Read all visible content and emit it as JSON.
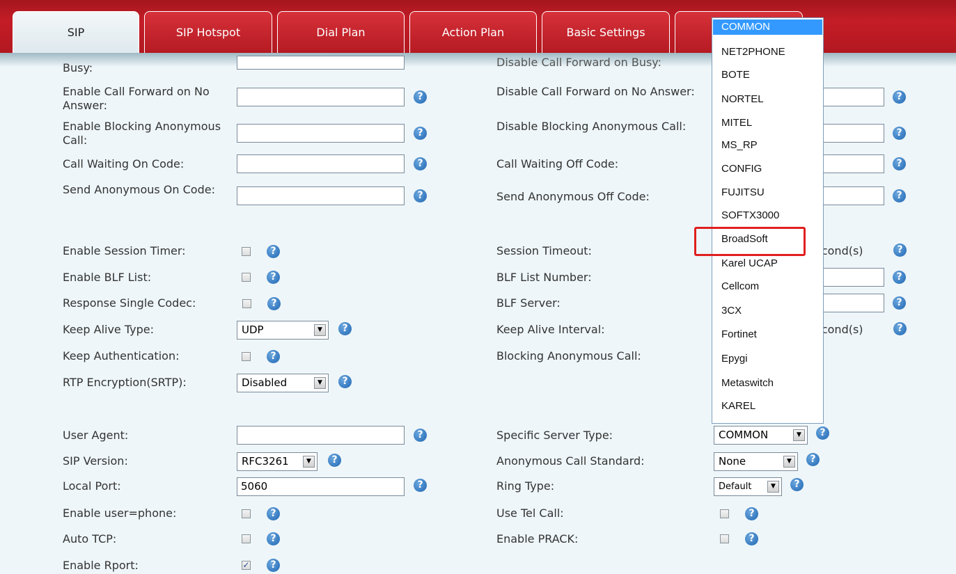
{
  "tabs": [
    "SIP",
    "SIP Hotspot",
    "Dial Plan",
    "Action Plan",
    "Basic Settings"
  ],
  "left": {
    "busy_label": "Busy:",
    "cf_no_answer_label": "Enable Call Forward on No Answer:",
    "blocking_anon_label": "Enable Blocking Anonymous Call:",
    "call_waiting_on_label": "Call Waiting On Code:",
    "send_anon_on_label": "Send Anonymous On Code:",
    "session_timer_label": "Enable Session Timer:",
    "blf_list_label": "Enable BLF List:",
    "single_codec_label": "Response Single Codec:",
    "keep_alive_type_label": "Keep Alive Type:",
    "keep_alive_type_value": "UDP",
    "keep_auth_label": "Keep Authentication:",
    "rtp_label": "RTP Encryption(SRTP):",
    "rtp_value": "Disabled",
    "user_agent_label": "User Agent:",
    "sip_version_label": "SIP Version:",
    "sip_version_value": "RFC3261",
    "local_port_label": "Local Port:",
    "local_port_value": "5060",
    "user_phone_label": "Enable user=phone:",
    "auto_tcp_label": "Auto TCP:",
    "rport_label": "Enable Rport:"
  },
  "right": {
    "disable_cf_busy_label": "Disable Call Forward on Busy:",
    "disable_cf_no_answer_label": "Disable Call Forward on No Answer:",
    "disable_blocking_label": "Disable Blocking Anonymous Call:",
    "call_waiting_off_label": "Call Waiting Off Code:",
    "send_anon_off_label": "Send Anonymous Off Code:",
    "session_timeout_label": "Session Timeout:",
    "session_timeout_unit": "econd(s)",
    "blf_number_label": "BLF List Number:",
    "blf_server_label": "BLF Server:",
    "keep_alive_interval_label": "Keep Alive Interval:",
    "keep_alive_interval_unit": "econd(s)",
    "blocking_anon_label": "Blocking Anonymous Call:",
    "server_type_label": "Specific Server Type:",
    "server_type_value": "COMMON",
    "anon_std_label": "Anonymous Call Standard:",
    "anon_std_value": "None",
    "ring_type_label": "Ring Type:",
    "ring_type_value": "Default",
    "tel_call_label": "Use Tel Call:",
    "prack_label": "Enable PRACK:"
  },
  "dropdown": {
    "options": [
      "COMMON",
      "NET2PHONE",
      "BOTE",
      "NORTEL",
      "MITEL",
      "MS_RP",
      "CONFIG",
      "FUJITSU",
      "SOFTX3000",
      "BroadSoft",
      "Karel UCAP",
      "Cellcom",
      "3CX",
      "Fortinet",
      "Epygi",
      "Metaswitch",
      "KAREL"
    ],
    "selected": "COMMON",
    "highlighted": "BroadSoft"
  },
  "help_glyph": "?",
  "check_glyph": "✓",
  "arrow_glyph": "▼",
  "colors": {
    "header_red": "#c41d27",
    "highlight_box": "#e0201f",
    "selected_option": "#3399ff"
  }
}
